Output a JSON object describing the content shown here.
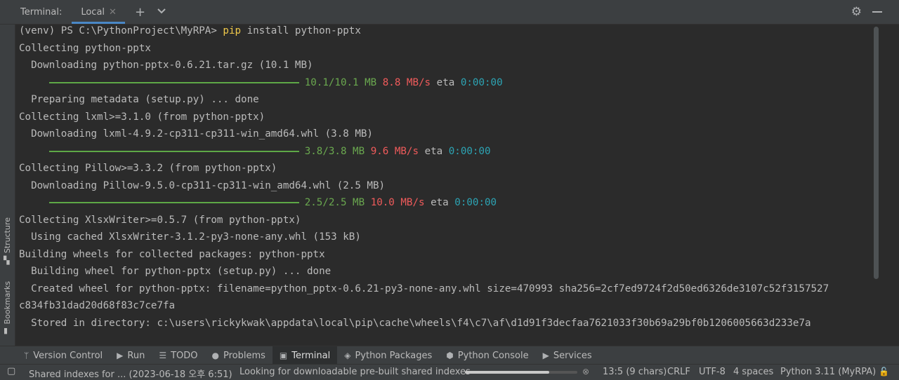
{
  "header": {
    "title": "Terminal:",
    "tab_label": "Local",
    "close_glyph": "✕",
    "add_glyph": "+",
    "dropdown_glyph": "⌄",
    "settings_glyph": "⚙"
  },
  "left_stripe": {
    "structure_label": "Structure",
    "bookmarks_label": "Bookmarks"
  },
  "terminal": {
    "lines": [
      {
        "parts": [
          {
            "t": "(venv) PS C:\\PythonProject\\MyRPA> "
          },
          {
            "t": "pip",
            "c": "pip"
          },
          {
            "t": " install python-pptx"
          }
        ]
      },
      {
        "parts": [
          {
            "t": "Collecting python-pptx"
          }
        ]
      },
      {
        "parts": [
          {
            "t": "  Downloading python-pptx-0.6.21.tar.gz (10.1 MB)"
          }
        ]
      },
      {
        "bar": true,
        "parts": [
          {
            "t": "10.1/10.1 MB",
            "c": "green"
          },
          {
            "t": " "
          },
          {
            "t": "8.8 MB/s",
            "c": "red"
          },
          {
            "t": " eta "
          },
          {
            "t": "0:00:00",
            "c": "cyan"
          }
        ]
      },
      {
        "parts": [
          {
            "t": "  Preparing metadata (setup.py) ... done"
          }
        ]
      },
      {
        "parts": [
          {
            "t": "Collecting lxml>=3.1.0 (from python-pptx)"
          }
        ]
      },
      {
        "parts": [
          {
            "t": "  Downloading lxml-4.9.2-cp311-cp311-win_amd64.whl (3.8 MB)"
          }
        ]
      },
      {
        "bar": true,
        "parts": [
          {
            "t": "3.8/3.8 MB",
            "c": "green"
          },
          {
            "t": " "
          },
          {
            "t": "9.6 MB/s",
            "c": "red"
          },
          {
            "t": " eta "
          },
          {
            "t": "0:00:00",
            "c": "cyan"
          }
        ]
      },
      {
        "parts": [
          {
            "t": "Collecting Pillow>=3.3.2 (from python-pptx)"
          }
        ]
      },
      {
        "parts": [
          {
            "t": "  Downloading Pillow-9.5.0-cp311-cp311-win_amd64.whl (2.5 MB)"
          }
        ]
      },
      {
        "bar": true,
        "parts": [
          {
            "t": "2.5/2.5 MB",
            "c": "green"
          },
          {
            "t": " "
          },
          {
            "t": "10.0 MB/s",
            "c": "red"
          },
          {
            "t": " eta "
          },
          {
            "t": "0:00:00",
            "c": "cyan"
          }
        ]
      },
      {
        "parts": [
          {
            "t": "Collecting XlsxWriter>=0.5.7 (from python-pptx)"
          }
        ]
      },
      {
        "parts": [
          {
            "t": "  Using cached XlsxWriter-3.1.2-py3-none-any.whl (153 kB)"
          }
        ]
      },
      {
        "parts": [
          {
            "t": "Building wheels for collected packages: python-pptx"
          }
        ]
      },
      {
        "parts": [
          {
            "t": "  Building wheel for python-pptx (setup.py) ... done"
          }
        ]
      },
      {
        "parts": [
          {
            "t": "  Created wheel for python-pptx: filename=python_pptx-0.6.21-py3-none-any.whl size=470993 sha256=2cf7ed9724f2d50ed6326de3107c52f3157527"
          }
        ]
      },
      {
        "parts": [
          {
            "t": "c834fb31dad20d68f83c7ce7fa"
          }
        ]
      },
      {
        "parts": [
          {
            "t": "  Stored in directory: c:\\users\\rickykwak\\appdata\\local\\pip\\cache\\wheels\\f4\\c7\\af\\d1d91f3decfaa7621033f30b69a29bf0b1206005663d233e7a"
          }
        ]
      }
    ]
  },
  "toolbar": {
    "items": [
      {
        "label": "Version Control",
        "icon": "branch-icon",
        "glyph": "ᛘ"
      },
      {
        "label": "Run",
        "icon": "run-icon",
        "glyph": "▶"
      },
      {
        "label": "TODO",
        "icon": "todo-icon",
        "glyph": "☰"
      },
      {
        "label": "Problems",
        "icon": "problems-icon",
        "glyph": "●"
      },
      {
        "label": "Terminal",
        "icon": "terminal-icon",
        "glyph": "▣",
        "active": true
      },
      {
        "label": "Python Packages",
        "icon": "packages-icon",
        "glyph": "◈"
      },
      {
        "label": "Python Console",
        "icon": "console-icon",
        "glyph": "⬢"
      },
      {
        "label": "Services",
        "icon": "services-icon",
        "glyph": "▶"
      }
    ]
  },
  "status": {
    "indexes": "Shared indexes for ... (2023-06-18 오후 6:51)",
    "looking": "Looking for downloadable pre-built shared indexes",
    "progress": 0.75,
    "position": "13:5 (9 chars)",
    "line_sep": "CRLF",
    "encoding": "UTF-8",
    "indent": "4 spaces",
    "interpreter": "Python 3.11 (MyRPA)"
  },
  "colors": {
    "accent": "#4a88c7",
    "pip": "#f0c94a",
    "green": "#6aa84f",
    "red": "#f05b5b",
    "cyan": "#2ca4b4"
  }
}
